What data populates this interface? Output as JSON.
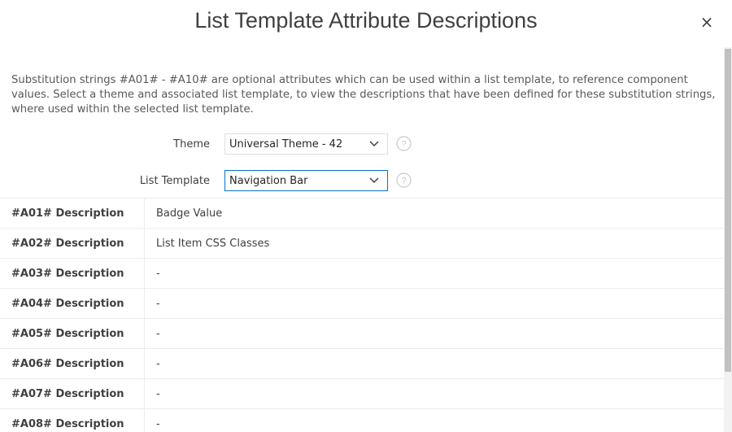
{
  "dialog": {
    "title": "List Template Attribute Descriptions",
    "close_symbol": "×"
  },
  "description": "Substitution strings #A01# - #A10# are optional attributes which can be used within a list template, to reference component values. Select a theme and associated list template, to view the descriptions that have been defined for these substitution strings, where used within the selected list template.",
  "form": {
    "theme": {
      "label": "Theme",
      "value": "Universal Theme - 42",
      "icon": "chevron-down-icon",
      "help_icon": "help-icon"
    },
    "list_template": {
      "label": "List Template",
      "value": "Navigation Bar",
      "icon": "chevron-down-icon",
      "help_icon": "help-icon"
    }
  },
  "table": {
    "rows": [
      {
        "label": "#A01# Description",
        "value": "Badge Value"
      },
      {
        "label": "#A02# Description",
        "value": "List Item CSS Classes"
      },
      {
        "label": "#A03# Description",
        "value": "-"
      },
      {
        "label": "#A04# Description",
        "value": "-"
      },
      {
        "label": "#A05# Description",
        "value": "-"
      },
      {
        "label": "#A06# Description",
        "value": "-"
      },
      {
        "label": "#A07# Description",
        "value": "-"
      },
      {
        "label": "#A08# Description",
        "value": "-"
      }
    ]
  },
  "colors": {
    "focus_border": "#0572ce",
    "text": "#404040",
    "border": "#dfdfdf"
  }
}
